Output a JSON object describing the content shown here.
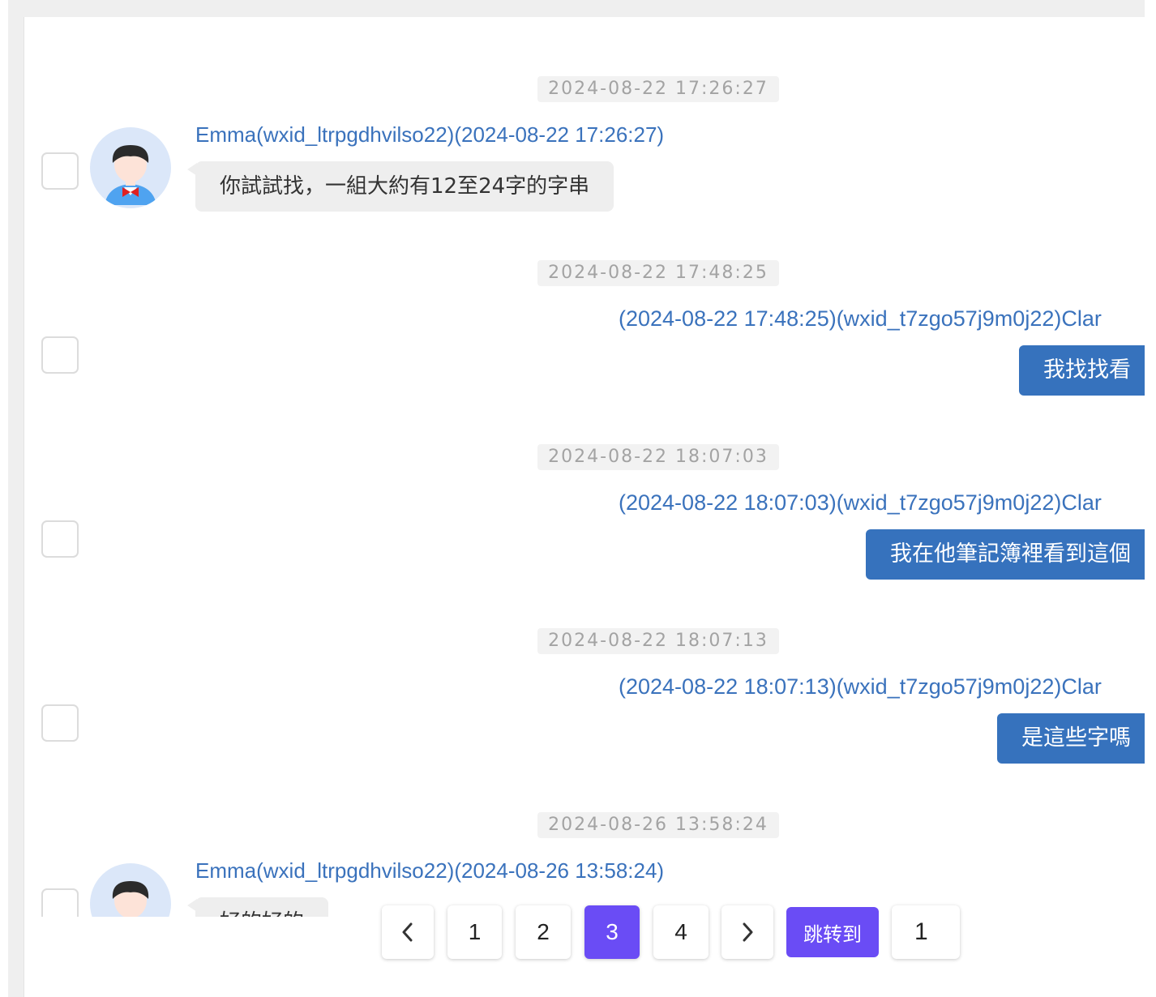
{
  "messages": [
    {
      "timestamp": "2024-08-22 17:26:27",
      "side": "left",
      "sender": "Emma(wxid_ltrpgdhvilso22)(2024-08-22 17:26:27)",
      "text": "你試試找，一組大約有12至24字的字串"
    },
    {
      "timestamp": "2024-08-22 17:48:25",
      "side": "right",
      "sender": "(2024-08-22 17:48:25)(wxid_t7zgo57j9m0j22)Clar",
      "text": "我找找看"
    },
    {
      "timestamp": "2024-08-22 18:07:03",
      "side": "right",
      "sender": "(2024-08-22 18:07:03)(wxid_t7zgo57j9m0j22)Clar",
      "text": "我在他筆記簿裡看到這個"
    },
    {
      "timestamp": "2024-08-22 18:07:13",
      "side": "right",
      "sender": "(2024-08-22 18:07:13)(wxid_t7zgo57j9m0j22)Clar",
      "text": "是這些字嗎"
    },
    {
      "timestamp": "2024-08-26 13:58:24",
      "side": "left",
      "sender": "Emma(wxid_ltrpgdhvilso22)(2024-08-26 13:58:24)",
      "text": "好的好的"
    }
  ],
  "pagination": {
    "prev": "‹",
    "pages": [
      "1",
      "2",
      "3",
      "4"
    ],
    "current": "3",
    "next": "›",
    "jump_label": "跳转到",
    "jump_value": "1"
  },
  "colors": {
    "accent": "#6a4cf5",
    "sender": "#3a72bc",
    "bubble_right": "#3672bd"
  }
}
